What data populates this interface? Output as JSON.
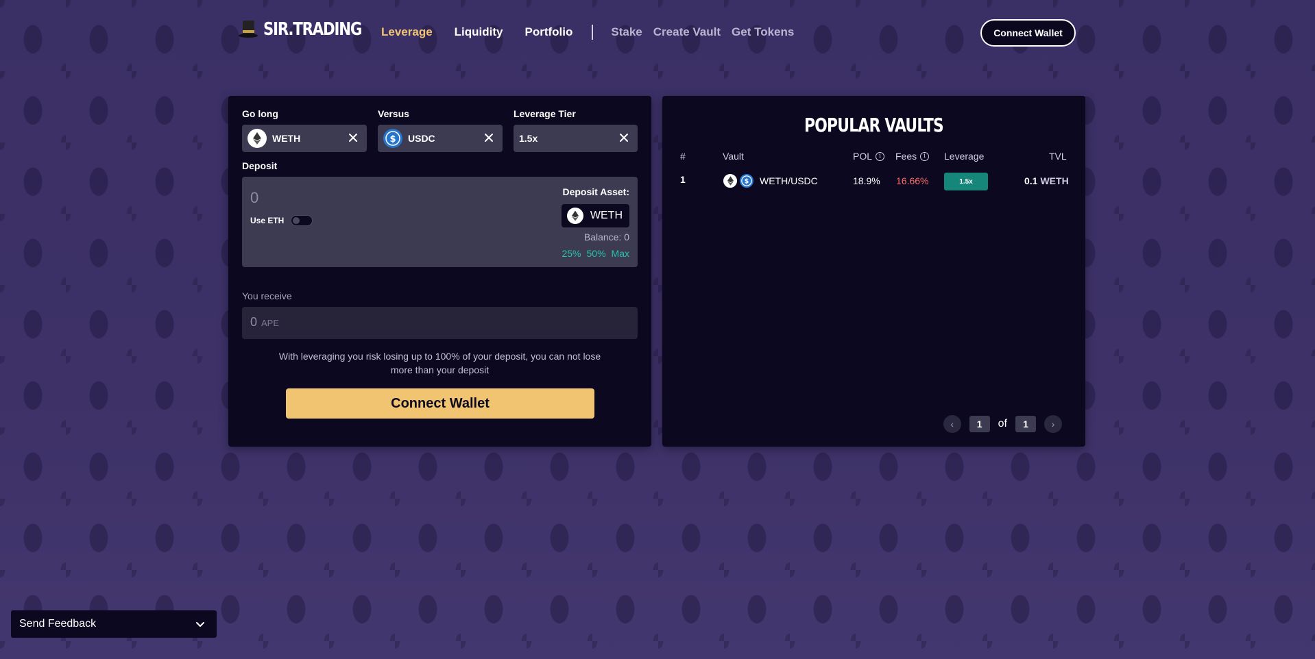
{
  "brand": {
    "name": "SIR.TRADING"
  },
  "nav": {
    "primary": [
      {
        "label": "Leverage",
        "active": true
      },
      {
        "label": "Liquidity",
        "active": false
      },
      {
        "label": "Portfolio",
        "active": false
      }
    ],
    "secondary": [
      {
        "label": "Stake"
      },
      {
        "label": "Create Vault"
      },
      {
        "label": "Get Tokens"
      }
    ],
    "connect_label": "Connect Wallet"
  },
  "form": {
    "go_long": {
      "label": "Go long",
      "value": "WETH"
    },
    "versus": {
      "label": "Versus",
      "value": "USDC"
    },
    "leverage_tier": {
      "label": "Leverage Tier",
      "value": "1.5x"
    },
    "deposit": {
      "label": "Deposit",
      "amount": "0",
      "use_eth_label": "Use ETH",
      "use_eth_on": false,
      "asset_label": "Deposit Asset:",
      "asset": "WETH",
      "balance": "Balance: 0",
      "quick": [
        "25%",
        "50%",
        "Max"
      ]
    },
    "receive": {
      "label": "You receive",
      "value": "0",
      "unit": "APE"
    },
    "warning": "With leveraging you risk losing up to 100% of your deposit, you can not lose more than your deposit",
    "connect_label": "Connect Wallet"
  },
  "popular_vaults": {
    "title": "POPULAR VAULTS",
    "columns": {
      "index": "#",
      "vault": "Vault",
      "pol": "POL",
      "fees": "Fees",
      "leverage": "Leverage",
      "tvl": "TVL"
    },
    "rows": [
      {
        "index": "1",
        "vault": "WETH/USDC",
        "pol": "18.9%",
        "fees": "16.66%",
        "leverage": "1.5x",
        "tvl_value": "0.1",
        "tvl_unit": "WETH"
      }
    ],
    "pager": {
      "current": "1",
      "of_label": "of",
      "total": "1"
    }
  },
  "feedback": {
    "label": "Send Feedback"
  },
  "colors": {
    "accent": "#f0c470",
    "teal": "#25c4ae",
    "fees": "#ff6b6b",
    "panel": "#0b081f"
  }
}
